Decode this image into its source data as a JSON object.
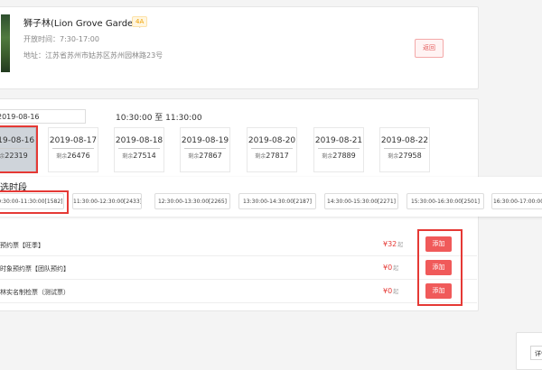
{
  "attraction": {
    "title": "狮子林(Lion Grove Garden)",
    "level_badge": "4A",
    "hours": "开放时间：7:30-17:00",
    "address": "地址：江苏省苏州市姑苏区苏州园林路23号",
    "back_label": "返回"
  },
  "booking": {
    "date_value": "2019-08-16",
    "time_range": "10:30:00 至 11:30:00",
    "remaining_key": "剩余",
    "dates": [
      {
        "date": "2019-08-16",
        "remaining": "22319",
        "selected": true
      },
      {
        "date": "2019-08-17",
        "remaining": "26476"
      },
      {
        "date": "2019-08-18",
        "remaining": "27514"
      },
      {
        "date": "2019-08-19",
        "remaining": "27867"
      },
      {
        "date": "2019-08-20",
        "remaining": "27817"
      },
      {
        "date": "2019-08-21",
        "remaining": "27889"
      },
      {
        "date": "2019-08-22",
        "remaining": "27958"
      }
    ],
    "slot_heading": "选时段",
    "slots": [
      "10:30:00-11:30:00[1582]",
      "11:30:00-12:30:00[2433]",
      "12:30:00-13:30:00[2265]",
      "13:30:00-14:30:00[2187]",
      "14:30:00-15:30:00[2271]",
      "15:30:00-16:30:00[2501]",
      "16:30:00-17:00:00"
    ],
    "tickets": [
      {
        "name": "预约票【旺季】",
        "price": "¥32",
        "unit": "起",
        "add": "添加"
      },
      {
        "name": "时象预约票【团队预约】",
        "price": "¥0",
        "unit": "起",
        "add": "添加"
      },
      {
        "name": "林实名制检票（测试票）",
        "price": "¥0",
        "unit": "起",
        "add": "添加"
      }
    ]
  },
  "float_button": "详情"
}
